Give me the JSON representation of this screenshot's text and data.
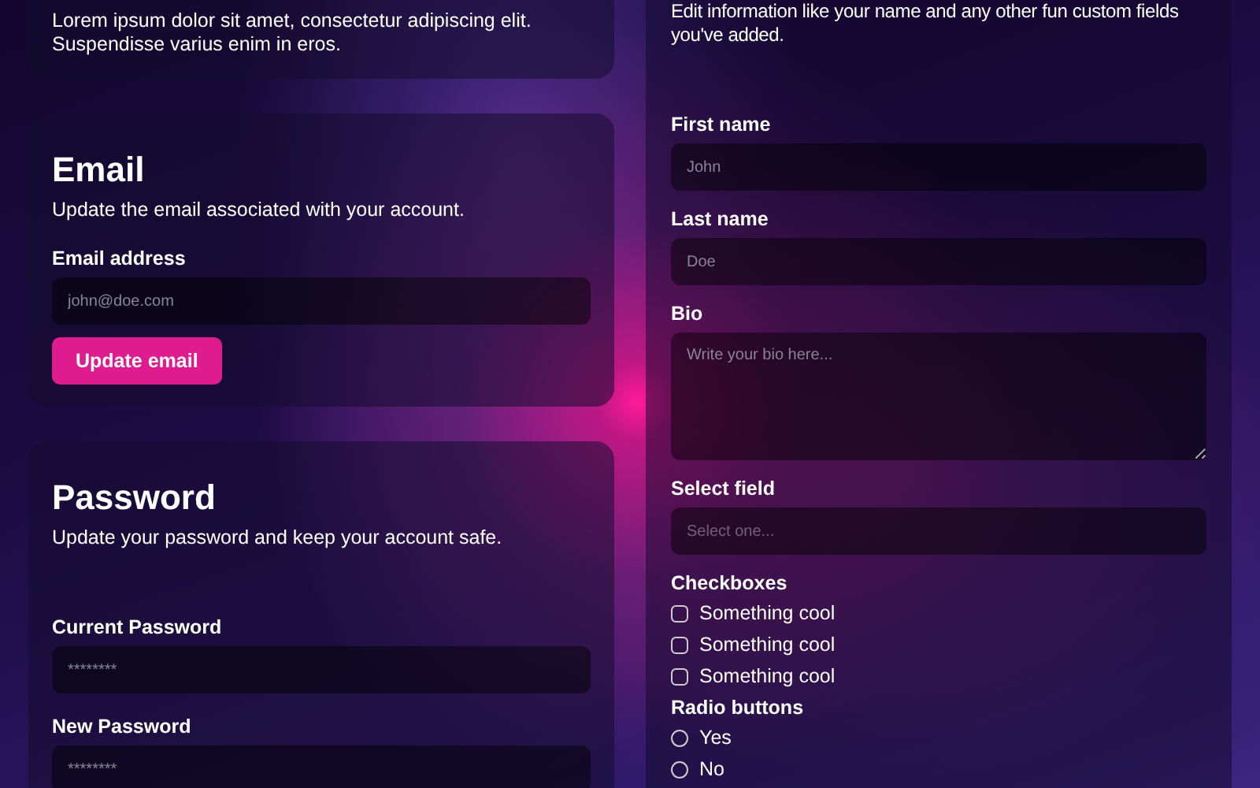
{
  "intro_card": {
    "description": "Lorem ipsum dolor sit amet, consectetur adipiscing elit. Suspendisse varius enim in eros."
  },
  "email_card": {
    "title": "Email",
    "description": "Update the email associated with your account.",
    "field": {
      "label": "Email address",
      "placeholder": "john@doe.com"
    },
    "button": "Update email"
  },
  "password_card": {
    "title": "Password",
    "description": "Update your password and keep your account safe.",
    "fields": [
      {
        "label": "Current Password",
        "placeholder": "********"
      },
      {
        "label": "New Password",
        "placeholder": "********"
      }
    ]
  },
  "profile_panel": {
    "description": "Edit information like your name and any other fun custom fields you've added.",
    "fields": [
      {
        "kind": "text",
        "label": "First name",
        "placeholder": "John"
      },
      {
        "kind": "text",
        "label": "Last name",
        "placeholder": "Doe"
      },
      {
        "kind": "textarea",
        "label": "Bio",
        "placeholder": "Write your bio here..."
      },
      {
        "kind": "select",
        "label": "Select field",
        "placeholder": "Select one..."
      }
    ],
    "checkboxes": {
      "label": "Checkboxes",
      "items": [
        {
          "label": "Something cool",
          "checked": false
        },
        {
          "label": "Something cool",
          "checked": false
        },
        {
          "label": "Something cool",
          "checked": false
        }
      ]
    },
    "radios": {
      "label": "Radio buttons",
      "items": [
        {
          "label": "Yes",
          "selected": false
        },
        {
          "label": "No",
          "selected": false
        }
      ]
    }
  }
}
